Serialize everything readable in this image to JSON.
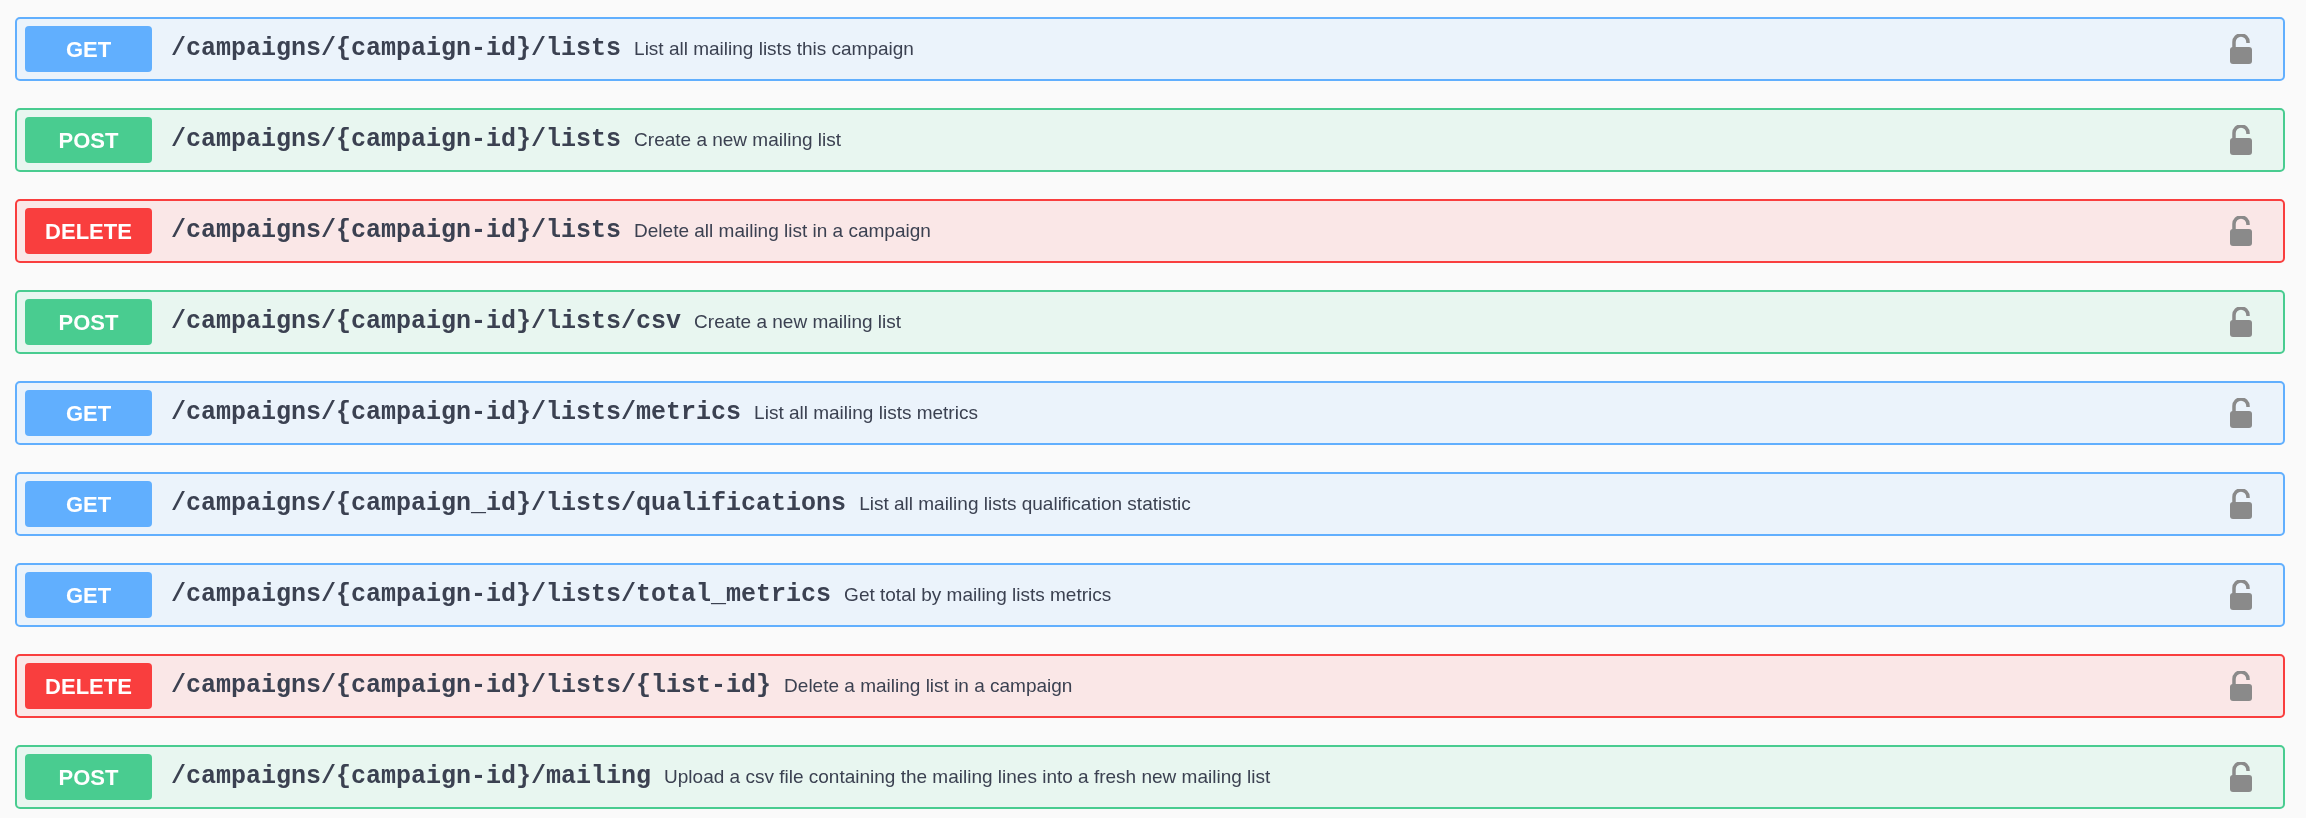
{
  "operations": [
    {
      "method": "GET",
      "path": "/campaigns/{campaign-id}/lists",
      "summary": "List all mailing lists this campaign"
    },
    {
      "method": "POST",
      "path": "/campaigns/{campaign-id}/lists",
      "summary": "Create a new mailing list"
    },
    {
      "method": "DELETE",
      "path": "/campaigns/{campaign-id}/lists",
      "summary": "Delete all mailing list in a campaign"
    },
    {
      "method": "POST",
      "path": "/campaigns/{campaign-id}/lists/csv",
      "summary": "Create a new mailing list"
    },
    {
      "method": "GET",
      "path": "/campaigns/{campaign-id}/lists/metrics",
      "summary": "List all mailing lists metrics"
    },
    {
      "method": "GET",
      "path": "/campaigns/{campaign_id}/lists/qualifications",
      "summary": "List all mailing lists qualification statistic"
    },
    {
      "method": "GET",
      "path": "/campaigns/{campaign-id}/lists/total_metrics",
      "summary": "Get total by mailing lists metrics"
    },
    {
      "method": "DELETE",
      "path": "/campaigns/{campaign-id}/lists/{list-id}",
      "summary": "Delete a mailing list in a campaign"
    },
    {
      "method": "POST",
      "path": "/campaigns/{campaign-id}/mailing",
      "summary": "Upload a csv file containing the mailing lines into a fresh new mailing list"
    }
  ]
}
